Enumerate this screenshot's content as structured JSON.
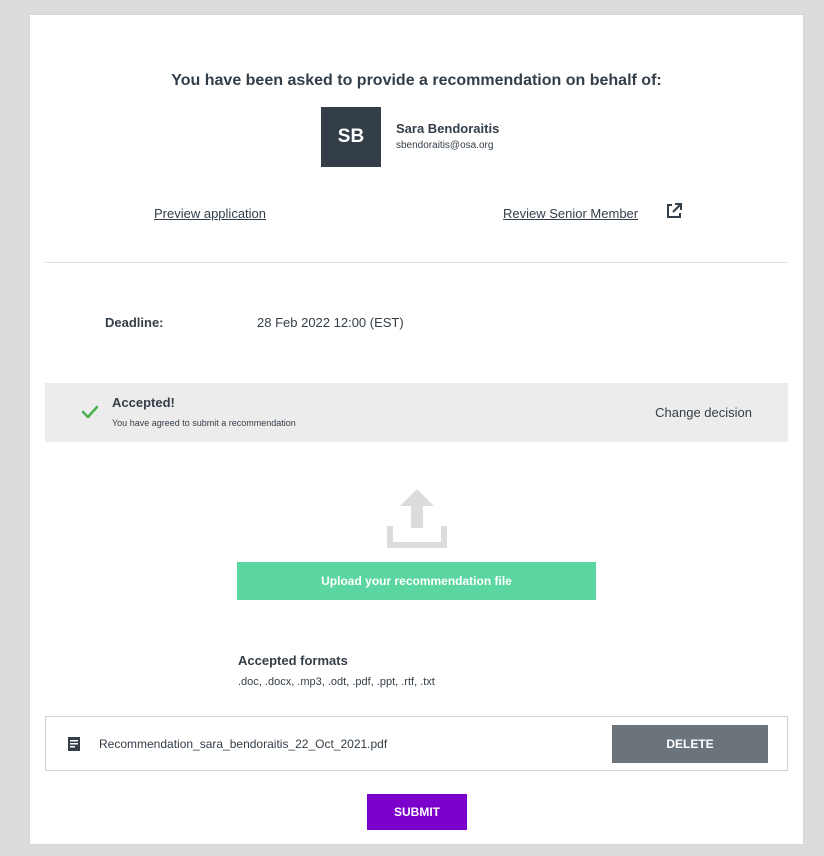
{
  "header": {
    "title": "You have been asked to provide a recommendation on behalf of:"
  },
  "applicant": {
    "initials": "SB",
    "name": "Sara Bendoraitis",
    "email": "sbendoraitis@osa.org"
  },
  "links": {
    "preview": "Preview application",
    "review": "Review Senior Member"
  },
  "deadline": {
    "label": "Deadline:",
    "value": "28 Feb 2022 12:00 (EST)"
  },
  "status": {
    "title": "Accepted!",
    "subtitle": "You have agreed to submit a recommendation",
    "change_label": "Change decision",
    "accent": "#4caf50"
  },
  "upload": {
    "icon": "upload-icon",
    "button_label": "Upload your recommendation file",
    "button_color": "#5bd6a1"
  },
  "formats": {
    "title": "Accepted formats",
    "list": ".doc, .docx, .mp3, .odt, .pdf, .ppt, .rtf, .txt"
  },
  "file": {
    "icon": "document-icon",
    "name": "Recommendation_sara_bendoraitis_22_Oct_2021.pdf",
    "delete_label": "DELETE"
  },
  "actions": {
    "submit_label": "SUBMIT",
    "submit_color": "#7b00cc"
  }
}
